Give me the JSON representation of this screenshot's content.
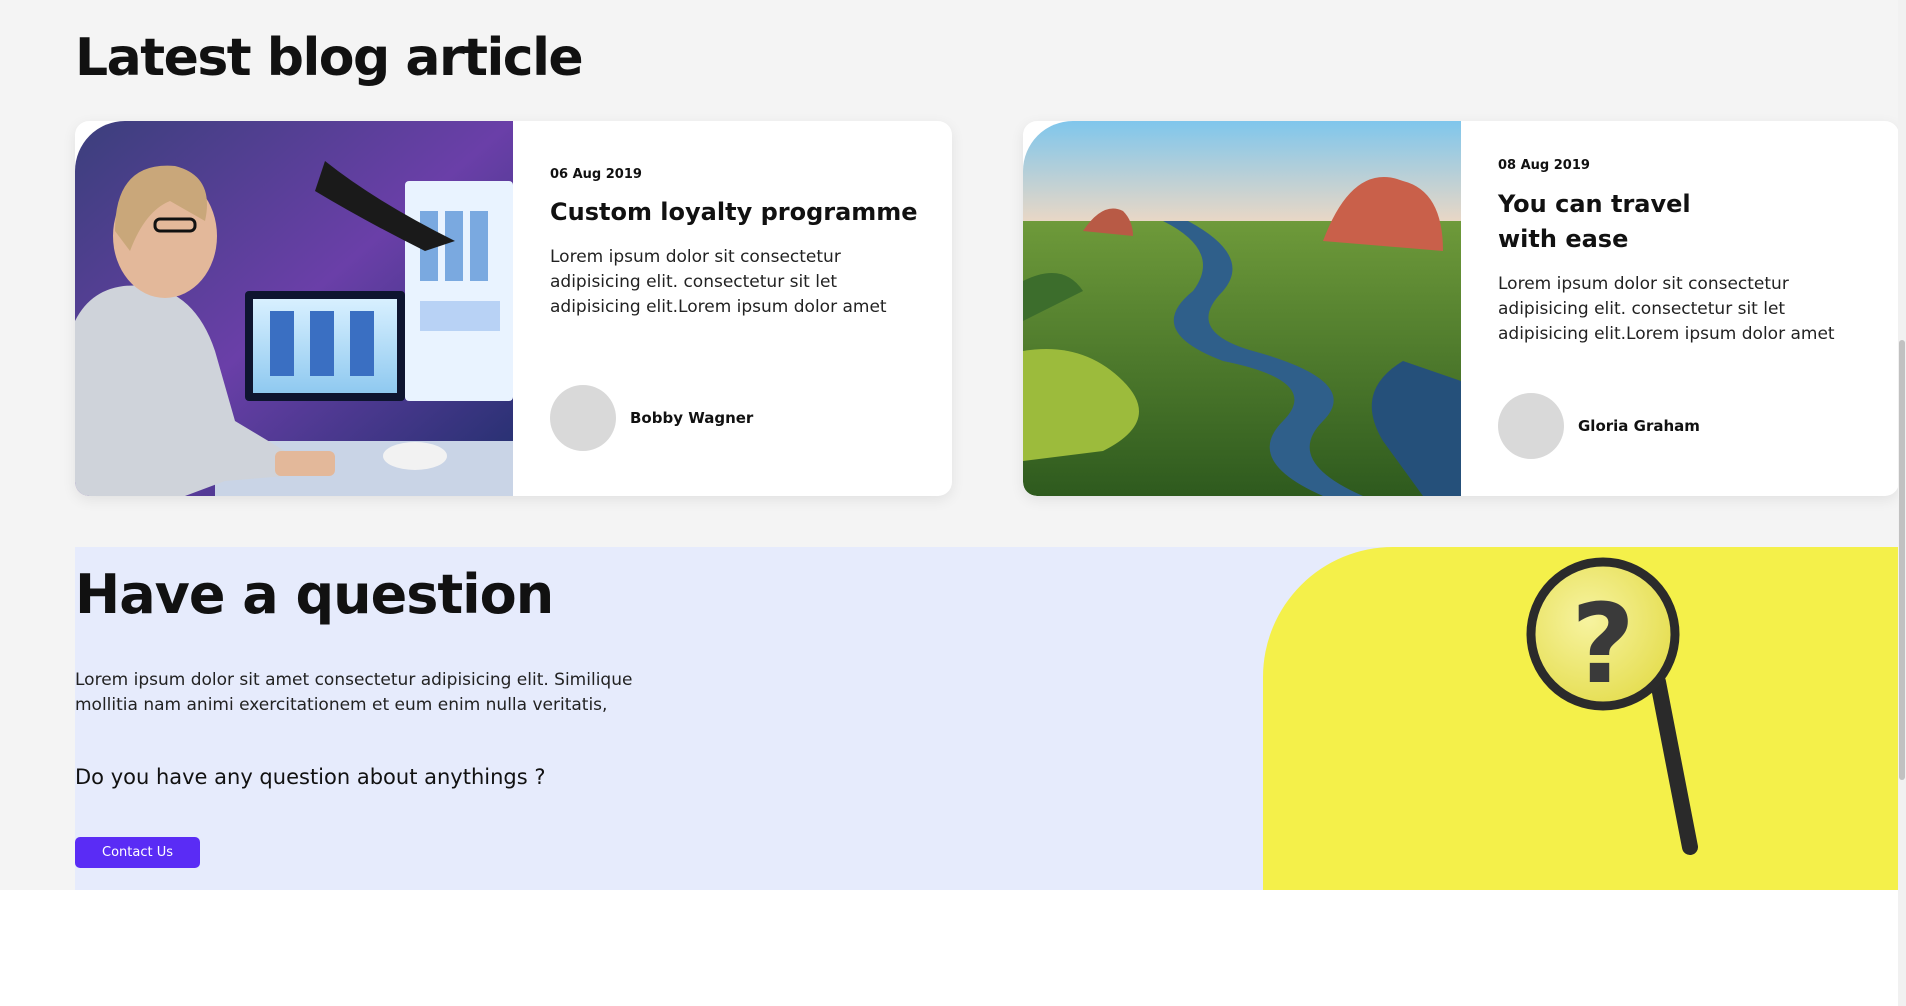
{
  "blog": {
    "title": "Latest blog article",
    "articles": [
      {
        "date": "06 Aug 2019",
        "title": "Custom loyalty programme",
        "excerpt": "Lorem ipsum dolor sit consectetur adipisicing elit. consectetur sit let adipisicing elit.Lorem ipsum dolor amet",
        "author": "Bobby Wagner"
      },
      {
        "date": "08 Aug 2019",
        "title": "You can travel with ease",
        "excerpt": "Lorem ipsum dolor sit consectetur adipisicing elit. consectetur sit let adipisicing elit.Lorem ipsum dolor amet",
        "author": "Gloria Graham"
      }
    ]
  },
  "question": {
    "title": "Have a question",
    "text": "Lorem ipsum dolor sit amet consectetur adipisicing elit. Similique mollitia nam animi exercitationem et eum enim nulla veritatis,",
    "subtitle": "Do you have any question about anythings ?",
    "button_label": "Contact Us"
  },
  "colors": {
    "accent": "#5a2cf5",
    "question_bg": "#e6ebfc",
    "art_bg": "#f4f04a",
    "page_bg": "#f4f4f4"
  },
  "icons": [
    "question-mark-icon",
    "magnifying-glass-icon"
  ]
}
